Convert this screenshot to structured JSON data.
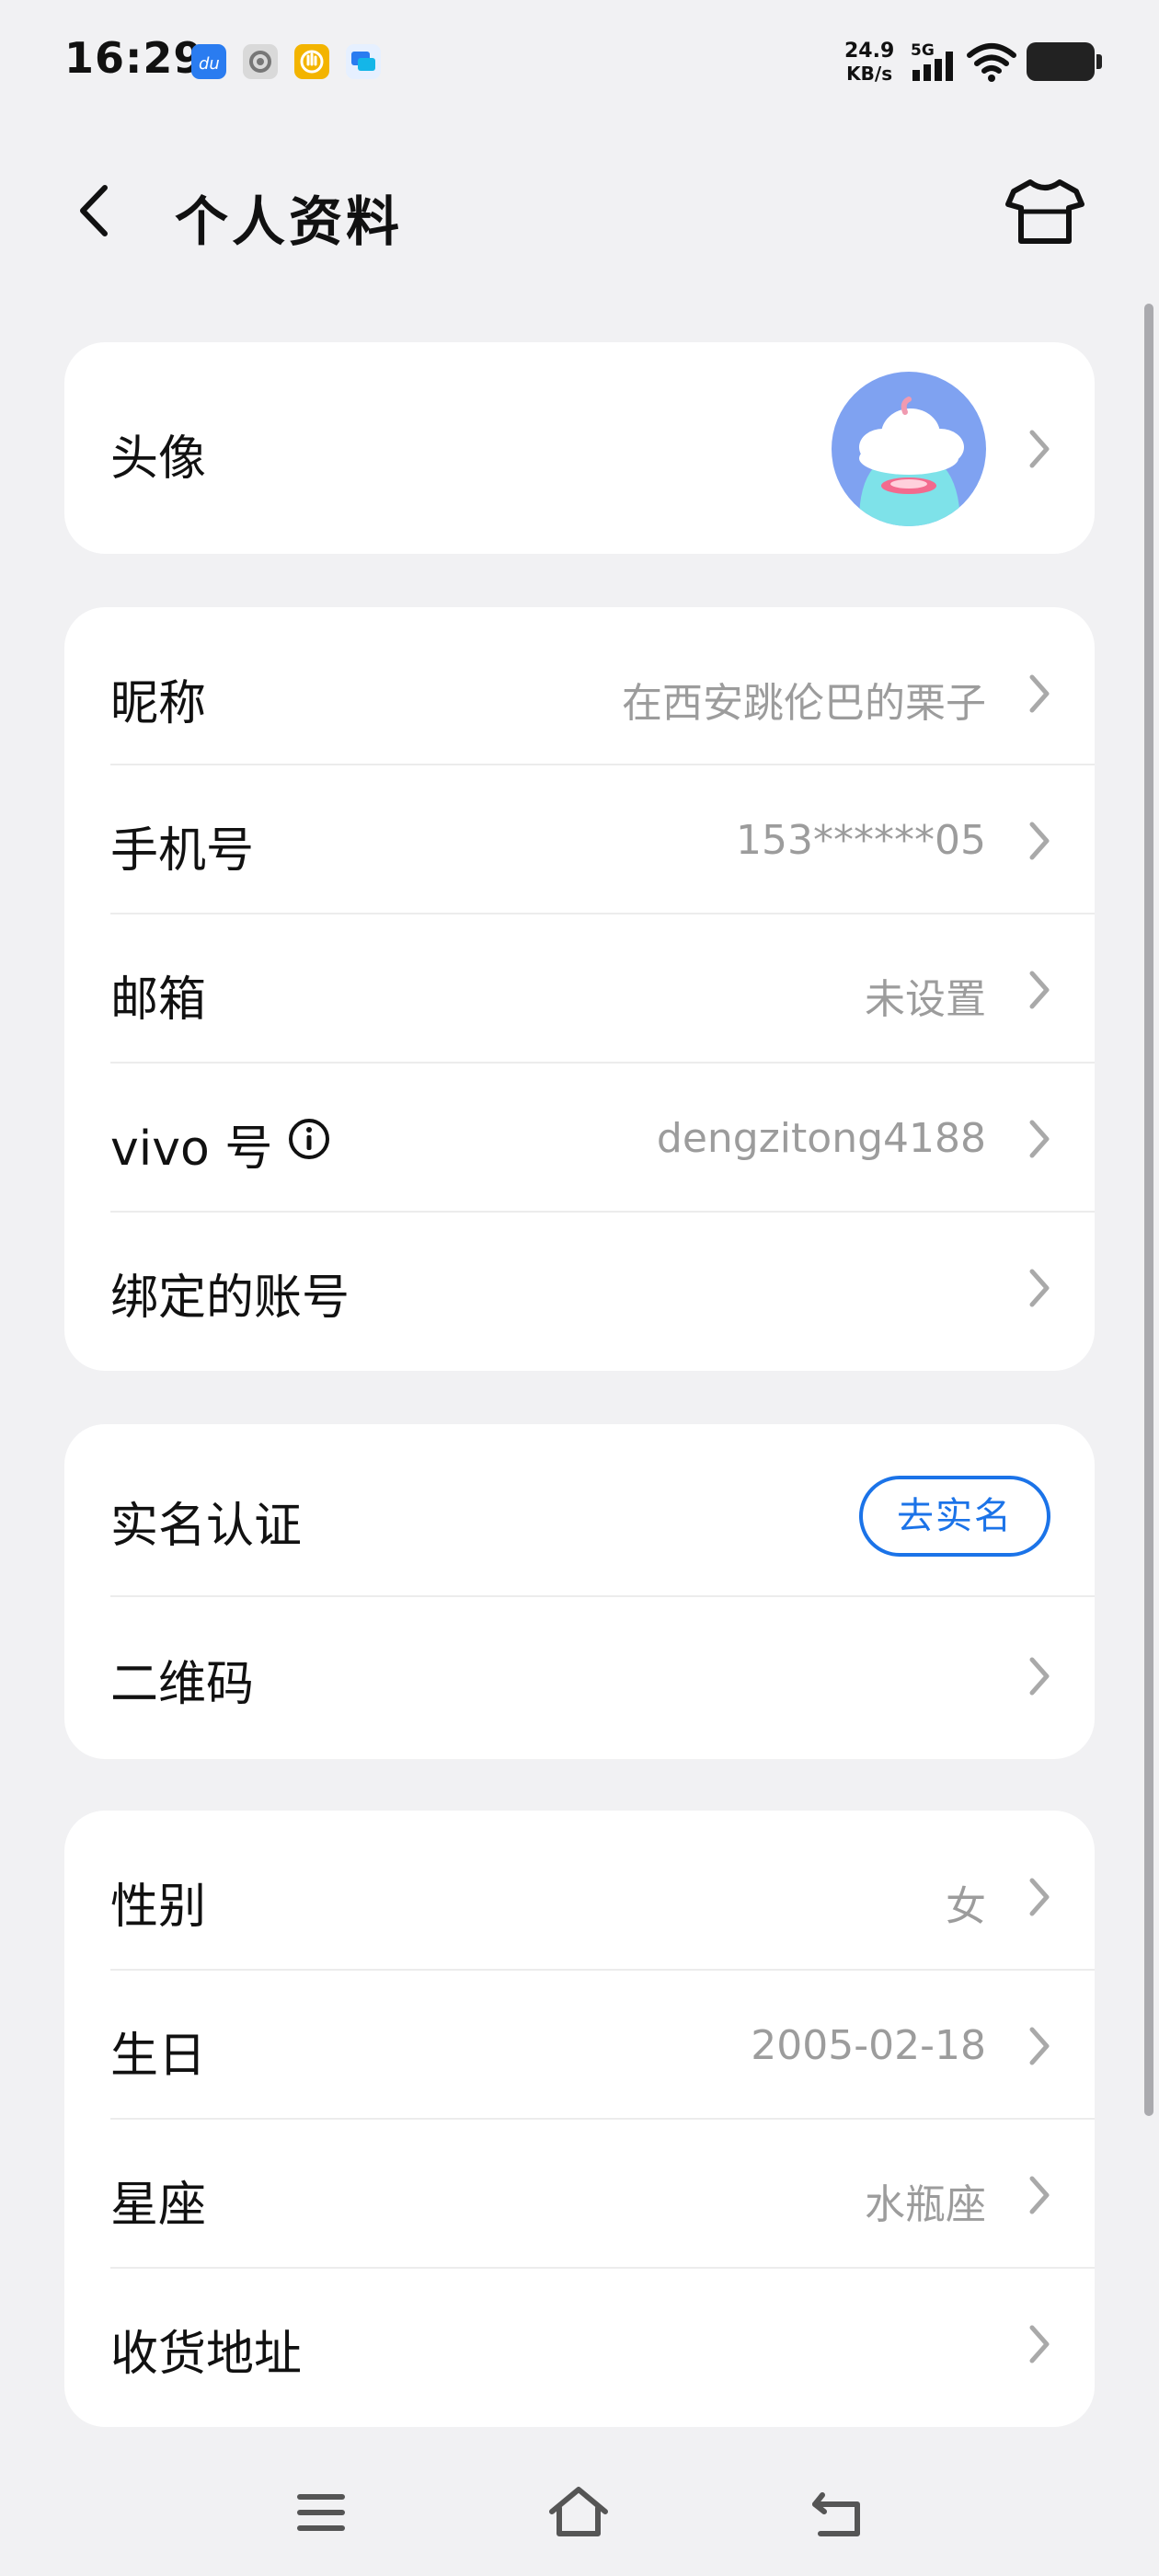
{
  "status_bar": {
    "time": "16:29",
    "net_speed_value": "24.9",
    "net_speed_unit": "KB/s",
    "network_type": "5G",
    "app_icons": [
      "du-app-icon",
      "camera-app-icon",
      "yellow-app-icon",
      "message-app-icon"
    ]
  },
  "header": {
    "title": "个人资料",
    "back_icon": "chevron-left-icon",
    "theme_icon": "tshirt-icon"
  },
  "sections": {
    "avatar": {
      "label": "头像"
    },
    "account": {
      "nickname": {
        "label": "昵称",
        "value": "在西安跳伦巴的栗子"
      },
      "phone": {
        "label": "手机号",
        "value": "153******05"
      },
      "email": {
        "label": "邮箱",
        "value": "未设置"
      },
      "vivo_id": {
        "label": "vivo 号",
        "value": "dengzitong4188"
      },
      "bound": {
        "label": "绑定的账号",
        "value": ""
      }
    },
    "identity": {
      "realname": {
        "label": "实名认证",
        "button": "去实名"
      },
      "qrcode": {
        "label": "二维码"
      }
    },
    "profile": {
      "gender": {
        "label": "性别",
        "value": "女"
      },
      "birthday": {
        "label": "生日",
        "value": "2005-02-18"
      },
      "zodiac": {
        "label": "星座",
        "value": "水瓶座"
      },
      "address": {
        "label": "收货地址",
        "value": ""
      }
    }
  },
  "colors": {
    "accent": "#1b73e8",
    "background": "#f1f1f3",
    "card": "#ffffff",
    "secondary_text": "#9c9c9c"
  },
  "navbar": {
    "icons": [
      "menu-icon",
      "home-icon",
      "back-icon"
    ]
  }
}
